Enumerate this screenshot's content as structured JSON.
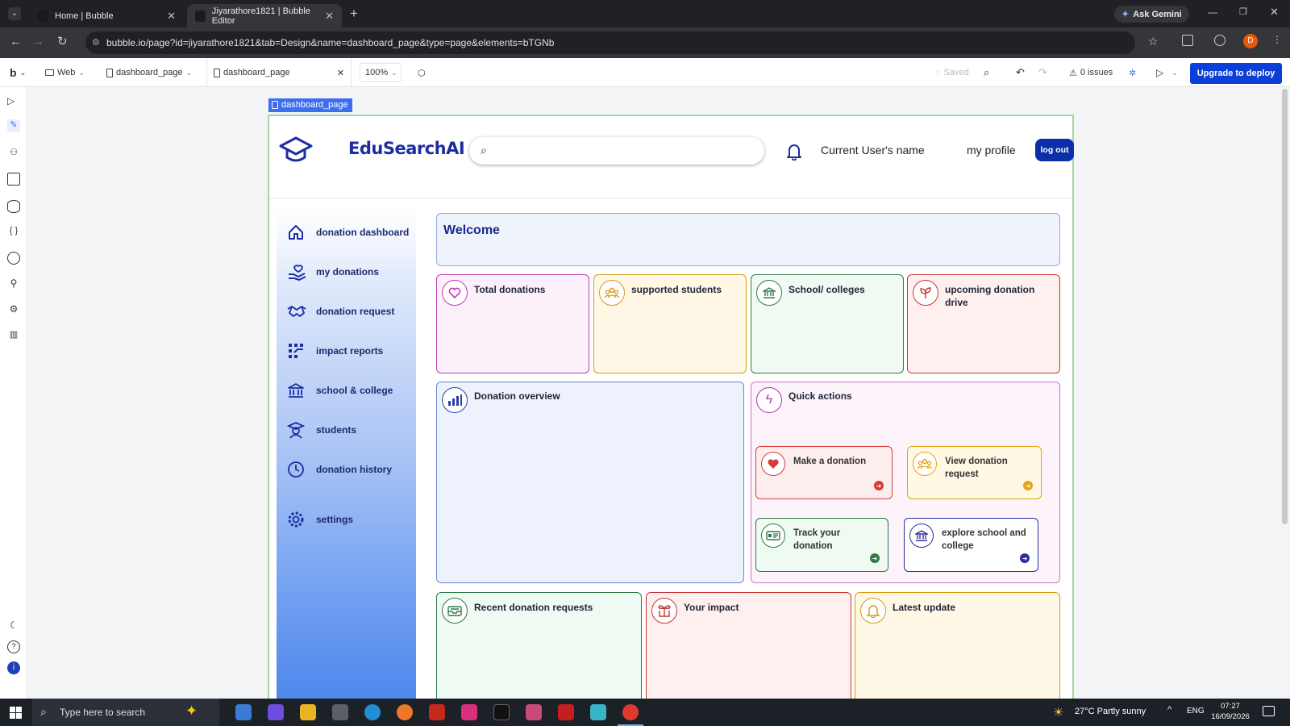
{
  "browser": {
    "tabs": [
      {
        "title": "Home | Bubble"
      },
      {
        "title": "Jiyarathore1821 | Bubble Editor"
      }
    ],
    "url": "bubble.io/page?id=jiyarathore1821&tab=Design&name=dashboard_page&type=page&elements=bTGNb",
    "ask_gemini": "Ask Gemini",
    "profile_initial": "D"
  },
  "editor": {
    "logo": "b",
    "platform": "Web",
    "page_select": "dashboard_page",
    "open_tab": "dashboard_page",
    "zoom": "100%",
    "saved": "Saved",
    "issues": "0 issues",
    "deploy": "Upgrade to deploy",
    "page_label": "dashboard_page"
  },
  "app": {
    "brand": "EduSearchAI",
    "search_placeholder": "",
    "user_name": "Current User's name",
    "my_profile": "my profile",
    "logout": "log out",
    "nav": [
      {
        "label": "donation dashboard",
        "icon": "home-icon"
      },
      {
        "label": "my donations",
        "icon": "hand-heart-icon"
      },
      {
        "label": "donation request",
        "icon": "handshake-icon"
      },
      {
        "label": "impact reports",
        "icon": "grid-chart-icon"
      },
      {
        "label": "school & college",
        "icon": "institution-icon"
      },
      {
        "label": "students",
        "icon": "student-icon"
      },
      {
        "label": "donation history",
        "icon": "clock-icon"
      },
      {
        "label": "settings",
        "icon": "gear-icon"
      }
    ],
    "welcome": "Welcome",
    "stats": [
      {
        "title": "Total donations",
        "icon": "heart-icon",
        "color": "#c33ab3",
        "bg": "#fcf1fb"
      },
      {
        "title": "supported students",
        "icon": "people-icon",
        "color": "#d89a15",
        "bg": "#fff8e6"
      },
      {
        "title": "School/ colleges",
        "icon": "institution-icon",
        "color": "#2f7a46",
        "bg": "#eefaf2"
      },
      {
        "title": "upcoming donation drive",
        "icon": "sprout-icon",
        "color": "#c93535",
        "bg": "#fdf0ee"
      }
    ],
    "overview_title": "Donation overview",
    "quick_actions": {
      "title": "Quick actions",
      "items": [
        {
          "title": "Make a donation",
          "icon": "heart-filled-icon",
          "color": "#d93a3a",
          "bg": "#fdeeee"
        },
        {
          "title": "View donation request",
          "icon": "people-icon",
          "color": "#e3a317",
          "bg": "#fff8e3"
        },
        {
          "title": "Track your donation",
          "icon": "id-card-icon",
          "color": "#2f7a46",
          "bg": "#eefaf2"
        },
        {
          "title": "explore school and college",
          "icon": "institution-icon",
          "color": "#2b2f9c",
          "bg": "#ffffff"
        }
      ]
    },
    "bottom": [
      {
        "title": "Recent donation requests",
        "icon": "inbox-icon",
        "color": "#2f7a46",
        "bg": "#eefaf2"
      },
      {
        "title": "Your impact",
        "icon": "gift-icon",
        "color": "#c93535",
        "bg": "#fdf0ee"
      },
      {
        "title": "Latest update",
        "icon": "bell-icon",
        "color": "#d89a15",
        "bg": "#fff8e6"
      }
    ]
  },
  "taskbar": {
    "search": "Type here to search",
    "weather": "27°C  Partly sunny",
    "lang": "ENG",
    "time": "07:27",
    "date": "16/09/2026"
  }
}
